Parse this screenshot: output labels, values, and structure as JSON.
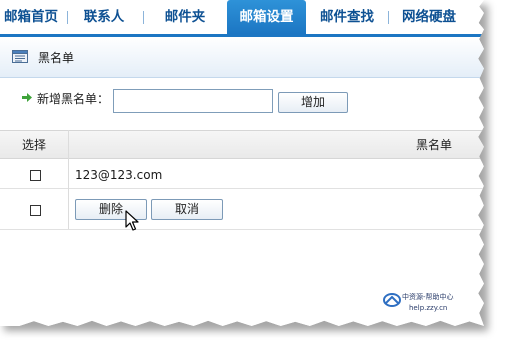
{
  "nav": {
    "items": [
      {
        "label": "邮箱首页",
        "active": false
      },
      {
        "label": "联系人",
        "active": false
      },
      {
        "label": "邮件夹",
        "active": false
      },
      {
        "label": "邮箱设置",
        "active": true
      },
      {
        "label": "邮件查找",
        "active": false
      },
      {
        "label": "网络硬盘",
        "active": false
      }
    ]
  },
  "section": {
    "title": "黑名单",
    "icon": "list-icon"
  },
  "add_form": {
    "label": "新增黑名单：",
    "input_value": "",
    "button_label": "增加"
  },
  "table": {
    "headers": {
      "select": "选择",
      "name": "黑名单"
    },
    "rows": [
      {
        "checked": false,
        "email": "123@123.com"
      }
    ]
  },
  "actions": {
    "delete_label": "删除",
    "cancel_label": "取消"
  },
  "watermark": {
    "line1": "中资源-帮助中心",
    "line2": "help.zzy.cn"
  },
  "colors": {
    "nav_active": "#1c76c3",
    "nav_text": "#0e5193",
    "section_bg": "#e4eef8"
  }
}
